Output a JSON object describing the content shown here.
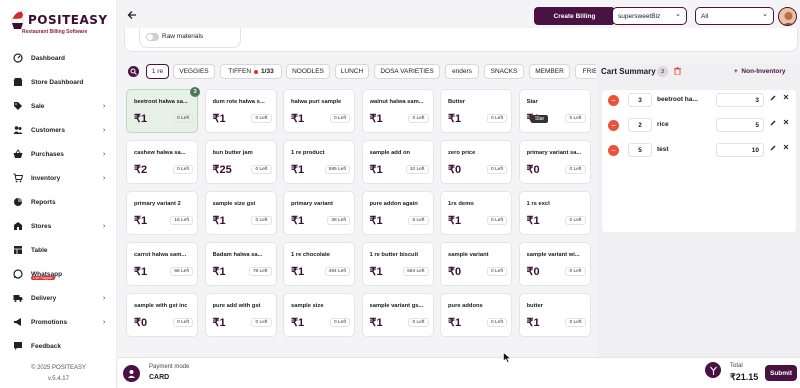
{
  "brand": {
    "title": "POSITEASY",
    "subtitle": "Restaurant Billing Software"
  },
  "sidebar": {
    "items": [
      {
        "label": "Dashboard",
        "icon": "gauge-icon",
        "chevron": false
      },
      {
        "label": "Store Dashboard",
        "icon": "store-icon",
        "chevron": false
      },
      {
        "label": "Sale",
        "icon": "tag-icon",
        "chevron": true
      },
      {
        "label": "Customers",
        "icon": "users-icon",
        "chevron": true
      },
      {
        "label": "Purchases",
        "icon": "basket-icon",
        "chevron": true
      },
      {
        "label": "Inventory",
        "icon": "cart-icon",
        "chevron": true
      },
      {
        "label": "Reports",
        "icon": "reports-icon",
        "chevron": false
      },
      {
        "label": "Stores",
        "icon": "stores-icon",
        "chevron": true
      },
      {
        "label": "Table",
        "icon": "table-icon",
        "chevron": false
      },
      {
        "label": "Whatsapp",
        "icon": "whatsapp-icon",
        "chevron": false
      },
      {
        "label": "Delivery",
        "icon": "truck-icon",
        "chevron": true
      },
      {
        "label": "Promotions",
        "icon": "megaphone-icon",
        "chevron": true
      },
      {
        "label": "Feedback",
        "icon": "feedback-icon",
        "chevron": false
      }
    ],
    "whatsapp_badge": "Live Support",
    "copyright": "© 2025 POSITEASY",
    "version": "v.5.4.17"
  },
  "topbar": {
    "create_billing": "Create Billing",
    "business_select": "supersweetBiz",
    "filter_select": "All"
  },
  "raw_materials_label": "Raw materials",
  "categories": [
    {
      "label": "1 re",
      "active": true
    },
    {
      "label": "VEGGIES",
      "active": false
    },
    {
      "label": "TIFFEN",
      "active": false,
      "dot": true,
      "suffix": "1/33"
    },
    {
      "label": "NOODLES",
      "active": false
    },
    {
      "label": "LUNCH",
      "active": false
    },
    {
      "label": "DOSA VARIETIES",
      "active": false
    },
    {
      "label": "enders",
      "active": false
    },
    {
      "label": "SNACKS",
      "active": false
    },
    {
      "label": "MEMBER",
      "active": false
    },
    {
      "label": "FRIE",
      "active": false
    }
  ],
  "products": [
    {
      "name": "beetroot halwa sa...",
      "price": "₹1",
      "left": "0 Left",
      "selected": true,
      "qty": "3"
    },
    {
      "name": "dum rote halwa s...",
      "price": "₹1",
      "left": "0 Left"
    },
    {
      "name": "halwa puri sample",
      "price": "₹1",
      "left": "0 Left"
    },
    {
      "name": "walnut halwa sam...",
      "price": "₹1",
      "left": "0 Left"
    },
    {
      "name": "Butter",
      "price": "₹1",
      "left": "0 Left"
    },
    {
      "name": "Star",
      "price": "₹1",
      "left": "0 Left"
    },
    {
      "name": "cashew halwa sa...",
      "price": "₹2",
      "left": "0 Left"
    },
    {
      "name": "bun butter jam",
      "price": "₹25",
      "left": "0 Left"
    },
    {
      "name": "1 re product",
      "price": "₹1",
      "left": "595 Left"
    },
    {
      "name": "sample add on",
      "price": "₹1",
      "left": "10 Left"
    },
    {
      "name": "zero price",
      "price": "₹0",
      "left": "0 Left"
    },
    {
      "name": "primary variant sa...",
      "price": "₹0",
      "left": "0 Left"
    },
    {
      "name": "primary variant 2",
      "price": "₹1",
      "left": "16 Left"
    },
    {
      "name": "sample size gst",
      "price": "₹1",
      "left": "0 Left"
    },
    {
      "name": "primary variant",
      "price": "₹1",
      "left": "38 Left"
    },
    {
      "name": "pure addon again",
      "price": "₹1",
      "left": "5 Left"
    },
    {
      "name": "1rs demo",
      "price": "₹1",
      "left": "0 Left"
    },
    {
      "name": "1 rs excl",
      "price": "₹1",
      "left": "0 Left"
    },
    {
      "name": "carrot halwa sam...",
      "price": "₹1",
      "left": "66 Left"
    },
    {
      "name": "Badam halwa sa...",
      "price": "₹1",
      "left": "78 Left"
    },
    {
      "name": "1 re chocolate",
      "price": "₹1",
      "left": "494 Left"
    },
    {
      "name": "1 re butter biscuit",
      "price": "₹1",
      "left": "584 Left"
    },
    {
      "name": "sample variant",
      "price": "₹0",
      "left": "0 Left"
    },
    {
      "name": "sample variant wi...",
      "price": "₹0",
      "left": "0 Left"
    },
    {
      "name": "sample with gst inc",
      "price": "₹0",
      "left": "0 Left"
    },
    {
      "name": "pure add with gst",
      "price": "₹1",
      "left": "0 Left"
    },
    {
      "name": "sample size",
      "price": "₹1",
      "left": "0 Left"
    },
    {
      "name": "sample variant gs...",
      "price": "₹1",
      "left": "0 Left"
    },
    {
      "name": "pure addons",
      "price": "₹1",
      "left": "0 Left"
    },
    {
      "name": "butter",
      "price": "₹1",
      "left": "0 Left"
    }
  ],
  "tooltip": "Star",
  "cart": {
    "title": "Cart Summary",
    "count": "3",
    "non_inventory": "Non-Inventory",
    "items": [
      {
        "qty": "3",
        "name": "beetroot ha...",
        "price": "3"
      },
      {
        "qty": "2",
        "name": "rice",
        "price": "5"
      },
      {
        "qty": "5",
        "name": "test",
        "price": "10"
      }
    ]
  },
  "footer": {
    "payment_label": "Payment mode",
    "payment_value": "CARD",
    "total_label": "Total",
    "total_value": "₹21.15",
    "submit": "Submit"
  },
  "colors": {
    "primary": "#4a1242",
    "danger": "#e8543a",
    "selected_card": "#e6f2e6"
  }
}
